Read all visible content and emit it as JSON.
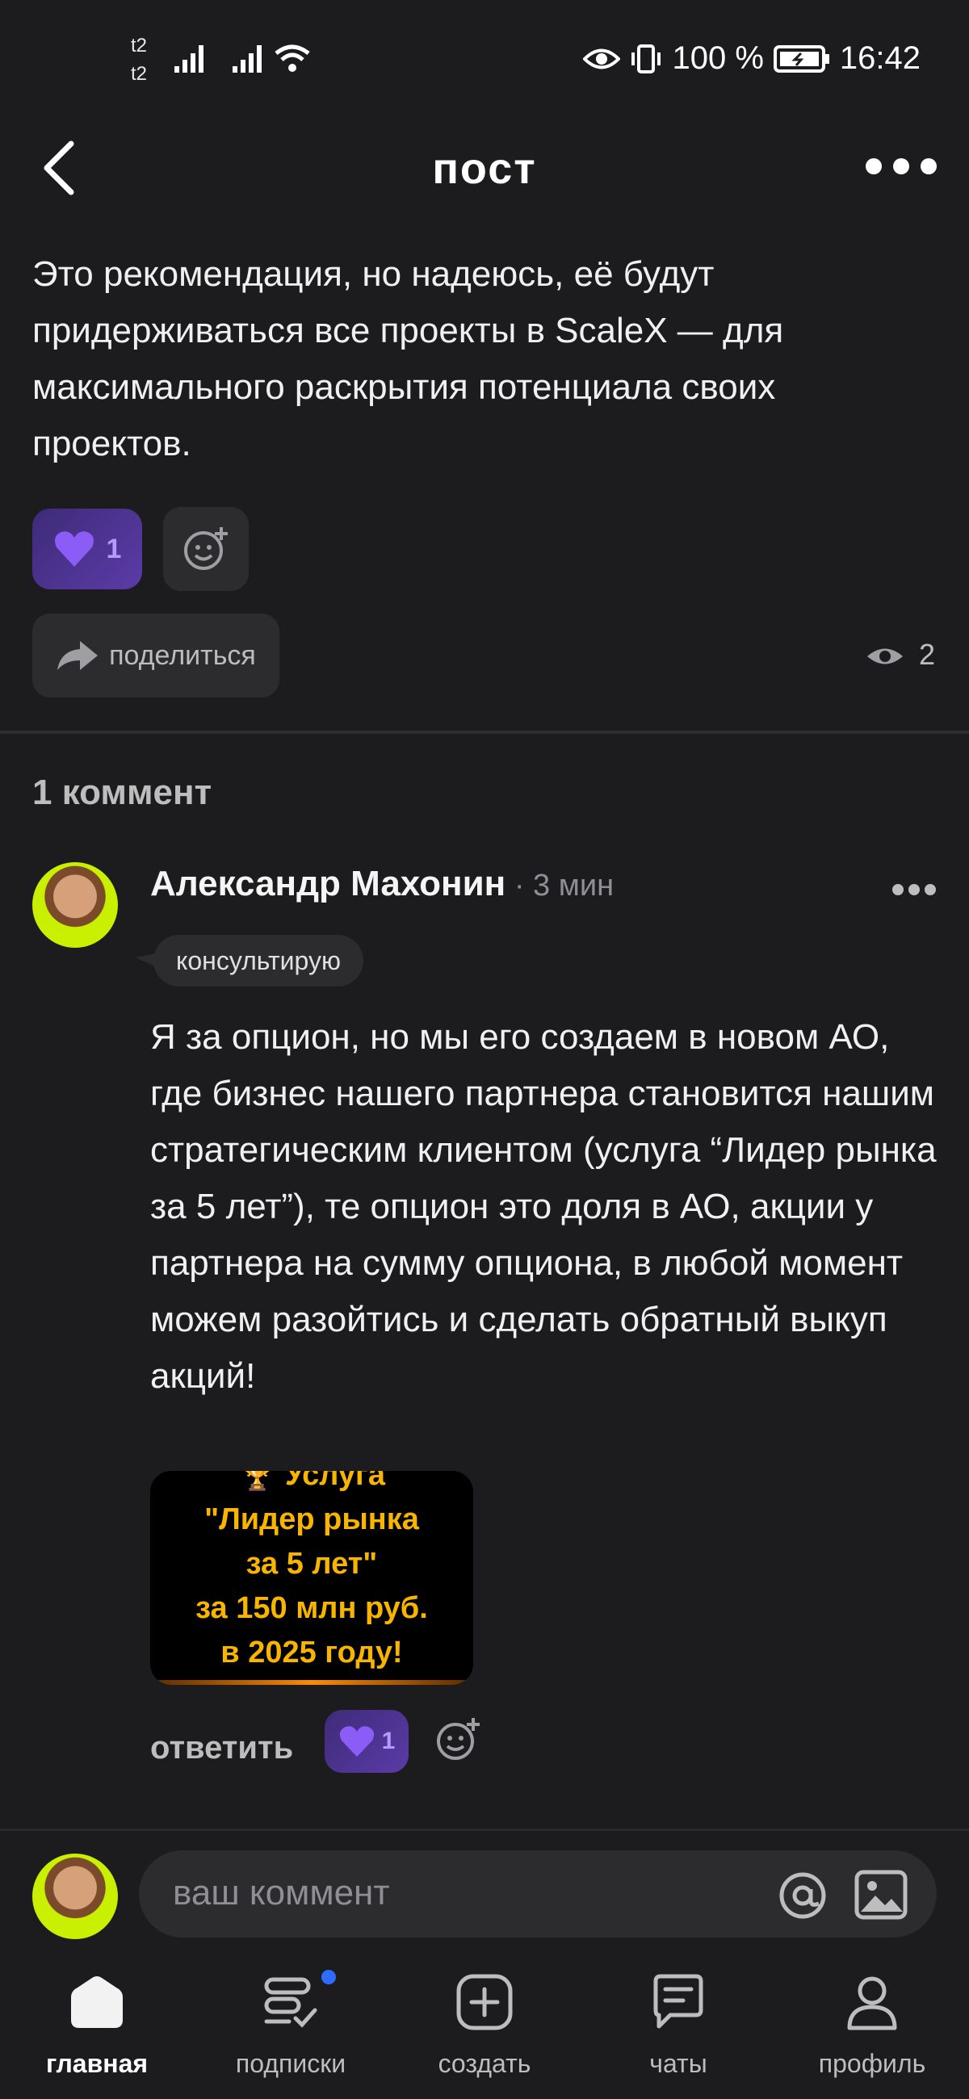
{
  "status_bar": {
    "carrier1": "t2",
    "carrier2": "t2",
    "battery": "100 %",
    "time": "16:42"
  },
  "header": {
    "title": "пост"
  },
  "post": {
    "text": "Это рекомендация, но надеюсь, её будут придерживаться все проекты в ScaleX — для максимального раскрытия потенциала своих проектов.",
    "like_count": "1",
    "share_label": "поделиться",
    "views": "2"
  },
  "comments": {
    "count_label": "1 коммент",
    "items": [
      {
        "author": "Александр Махонин",
        "time": " · 3 мин",
        "tag": "консультирую",
        "text": "Я за опцион, но мы его создаем в новом АО, где бизнес нашего партнера становится нашим стратегическим клиентом (услуга “Лидер рынка за 5 лет”), те опцион это доля в АО, акции у партнера на сумму опциона, в любой момент можем разойтись и сделать обратный выкуп акций!",
        "image_lines": [
          "🏆 Услуга",
          "\"Лидер рынка",
          "за 5 лет\"",
          "за 150 млн руб.",
          "в 2025 году!"
        ],
        "reply_label": "ответить",
        "like_count": "1"
      }
    ]
  },
  "composer": {
    "placeholder": "ваш коммент"
  },
  "nav": {
    "items": [
      {
        "label": "главная",
        "icon": "home-icon"
      },
      {
        "label": "подписки",
        "icon": "subscriptions-icon"
      },
      {
        "label": "создать",
        "icon": "create-icon"
      },
      {
        "label": "чаты",
        "icon": "chat-icon"
      },
      {
        "label": "профиль",
        "icon": "profile-icon"
      }
    ]
  },
  "colors": {
    "background": "#1c1c1e",
    "like_accent": "#8b5cf6",
    "promo_text": "#f7b500",
    "notification_dot": "#2f6bff"
  }
}
